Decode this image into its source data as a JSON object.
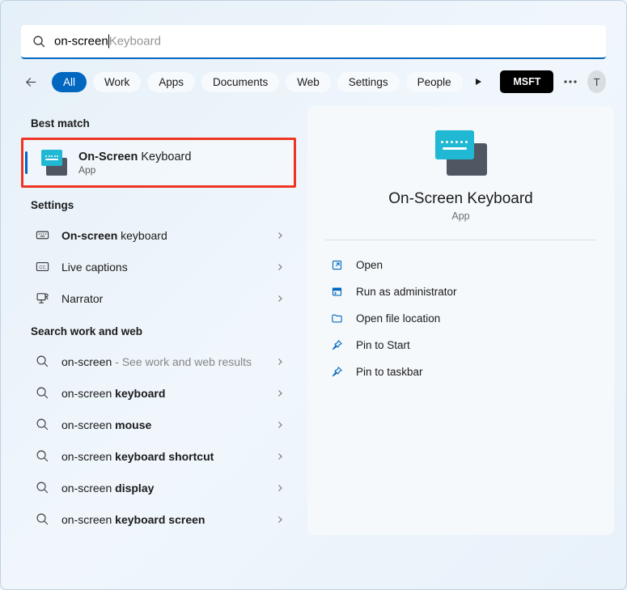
{
  "search": {
    "typed": "on-screen",
    "completion": "Keyboard"
  },
  "filters": {
    "items": [
      "All",
      "Work",
      "Apps",
      "Documents",
      "Web",
      "Settings",
      "People"
    ],
    "active_index": 0
  },
  "header": {
    "account_label": "MSFT",
    "avatar_initial": "T"
  },
  "sections": {
    "best_match": "Best match",
    "settings": "Settings",
    "web": "Search work and web"
  },
  "best_match_item": {
    "title_bold": "On-Screen",
    "title_rest": " Keyboard",
    "subtitle": "App"
  },
  "settings_items": [
    {
      "bold": "On-screen",
      "rest": " keyboard",
      "icon": "keyboard"
    },
    {
      "bold": "",
      "rest": "Live captions",
      "icon": "cc"
    },
    {
      "bold": "",
      "rest": "Narrator",
      "icon": "narrator"
    }
  ],
  "web_items": [
    {
      "prefix": "on-screen",
      "bold": "",
      "suffix": " - See work and web results",
      "muted_suffix": true
    },
    {
      "prefix": "on-screen ",
      "bold": "keyboard",
      "suffix": ""
    },
    {
      "prefix": "on-screen ",
      "bold": "mouse",
      "suffix": ""
    },
    {
      "prefix": "on-screen ",
      "bold": "keyboard shortcut",
      "suffix": ""
    },
    {
      "prefix": "on-screen ",
      "bold": "display",
      "suffix": ""
    },
    {
      "prefix": "on-screen ",
      "bold": "keyboard screen",
      "suffix": ""
    }
  ],
  "preview": {
    "title": "On-Screen Keyboard",
    "subtitle": "App"
  },
  "actions": [
    {
      "label": "Open",
      "icon": "open"
    },
    {
      "label": "Run as administrator",
      "icon": "admin"
    },
    {
      "label": "Open file location",
      "icon": "folder"
    },
    {
      "label": "Pin to Start",
      "icon": "pin"
    },
    {
      "label": "Pin to taskbar",
      "icon": "pin"
    }
  ],
  "colors": {
    "accent": "#0067c0",
    "highlight_border": "#ee3524"
  }
}
